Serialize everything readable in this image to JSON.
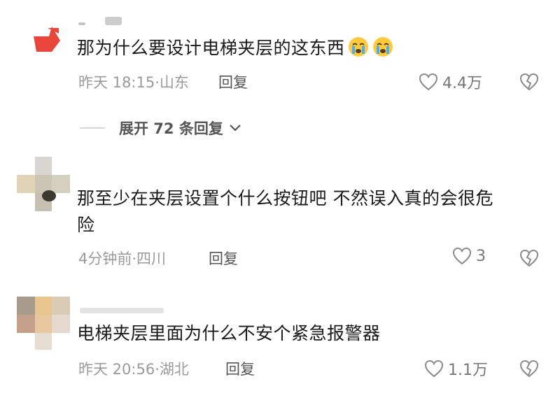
{
  "comments": [
    {
      "text": "那为什么要设计电梯夹层的这东西",
      "time_location": "昨天 18:15·山东",
      "reply_label": "回复",
      "like_count": "4.4万",
      "emoji": [
        "crying-face",
        "crying-face"
      ]
    },
    {
      "text_line1": "那至少在夹层设置个什么按钮吧 不然误入真的会很危",
      "text_line2": "险",
      "time_location": "4分钟前·四川",
      "reply_label": "回复",
      "like_count": "3"
    },
    {
      "text": "电梯夹层里面为什么不安个紧急报警器",
      "time_location": "昨天 20:56·湖北",
      "reply_label": "回复",
      "like_count": "1.1万"
    }
  ],
  "expand_replies": {
    "label": "展开 72 条回复"
  },
  "colors": {
    "text": "#1a1a1a",
    "meta": "#9a9a9a",
    "icon": "#8a8a8a",
    "avatar_accent": "#e8453c"
  }
}
